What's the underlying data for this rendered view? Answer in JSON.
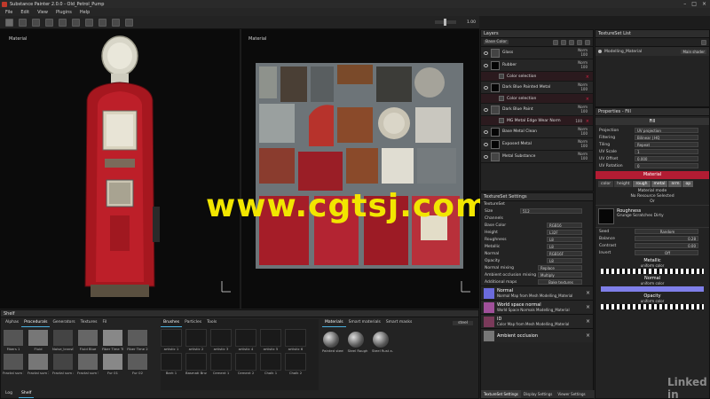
{
  "window": {
    "title": "Substance Painter 2.0.0 - Old_Petrol_Pump"
  },
  "menu": [
    "File",
    "Edit",
    "View",
    "Plugins",
    "Help"
  ],
  "viewport": {
    "left_label": "Material",
    "right_label": "Material",
    "zoom": "1.00"
  },
  "layers": {
    "title": "Layers",
    "blend_select": "Base Color",
    "items": [
      {
        "name": "Glass",
        "blend": "Norm",
        "opacity": "100",
        "mask": false,
        "thumb": "grey"
      },
      {
        "name": "Rubber",
        "blend": "Norm",
        "opacity": "100",
        "mask": false,
        "thumb": "black"
      },
      {
        "name": "Color selection",
        "mask": true
      },
      {
        "name": "Dark Blue Painted Metal",
        "blend": "Norm",
        "opacity": "100",
        "mask": false,
        "thumb": "black"
      },
      {
        "name": "Color selection",
        "mask": true
      },
      {
        "name": "Dark Blue Paint",
        "blend": "Norm",
        "opacity": "100",
        "mask": false,
        "thumb": "grey"
      },
      {
        "name": "MG Metal Edge Wear Norm",
        "blend": "100",
        "opacity": "",
        "mask": true
      },
      {
        "name": "Base Metal Clean",
        "blend": "Norm",
        "opacity": "100",
        "mask": false,
        "thumb": "black"
      },
      {
        "name": "Exposed Metal",
        "blend": "Norm",
        "opacity": "100",
        "mask": false,
        "thumb": "black"
      },
      {
        "name": "Metal Substance",
        "blend": "Norm",
        "opacity": "100",
        "mask": false,
        "thumb": "grey"
      }
    ]
  },
  "texture_set_list": {
    "title": "TextureSet List",
    "item": "Modelling_Material",
    "shader": "Main shader"
  },
  "texture_set_settings": {
    "title": "TextureSet Settings",
    "stack": "TextureSet",
    "size_label": "Size",
    "size_value": "512",
    "channels_label": "Channels",
    "channels": [
      {
        "name": "Base Color",
        "format": "RGB16"
      },
      {
        "name": "Height",
        "format": "L32F"
      },
      {
        "name": "Roughness",
        "format": "L8"
      },
      {
        "name": "Metallic",
        "format": "L8"
      },
      {
        "name": "Normal",
        "format": "RGB16F"
      },
      {
        "name": "Opacity",
        "format": "L8"
      }
    ],
    "normal_mixing_label": "Normal mixing",
    "normal_mixing_value": "Replace",
    "ao_mixing_label": "Ambient occlusion mixing",
    "ao_mixing_value": "Multiply",
    "additional_maps_label": "Additional maps",
    "bake_button": "Bake textures",
    "maps": [
      {
        "title": "Normal",
        "desc": "Normal Map from Mesh Modelling_Material",
        "color": "#6b6bdc"
      },
      {
        "title": "World space normal",
        "desc": "World Space Normals Modelling_Material",
        "color": "#a0509a"
      },
      {
        "title": "ID",
        "desc": "Color Map from Mesh Modelling_Material",
        "color": "#7a3a5a"
      },
      {
        "title": "Ambient occlusion",
        "desc": "",
        "color": "#777777"
      }
    ],
    "bottom_tabs": [
      "TextureSet Settings",
      "Display Settings",
      "Viewer Settings"
    ]
  },
  "properties": {
    "title": "Properties - Fill",
    "fill_header": "Fill",
    "rows": [
      {
        "label": "Projection",
        "value": "UV projection"
      },
      {
        "label": "Filtering",
        "value": "Bilinear | HQ"
      },
      {
        "label": "Tiling",
        "value": "Repeat"
      },
      {
        "label": "UV Scale",
        "value": "1"
      },
      {
        "label": "UV Offset",
        "value": "0.000"
      },
      {
        "label": "UV Rotation",
        "value": "0"
      }
    ],
    "material_header": "Material",
    "channel_tabs": [
      "color",
      "height",
      "rough",
      "metal",
      "nrm",
      "op"
    ],
    "material_mode_label": "Material mode",
    "material_mode_value": "No Resource Selected",
    "or_text": "Or",
    "roughness_title": "Roughness",
    "roughness_value": "Grunge Scratches Dirty",
    "seed_label": "Seed",
    "seed_value": "Random",
    "balance_label": "Balance",
    "balance_value": "0.28",
    "contrast_label": "Contrast",
    "contrast_value": "0.00",
    "invert_label": "Invert",
    "invert_value": "Off",
    "metallic_title": "Metallic",
    "metallic_sub": "uniform color",
    "normal_title": "Normal",
    "normal_sub": "uniform color",
    "opacity_title": "Opacity",
    "opacity_sub": "uniform color"
  },
  "shelf": {
    "title": "Shelf",
    "left_tabs": [
      "Alphas",
      "Procedurals",
      "Generators",
      "Textures",
      "Fil"
    ],
    "left_items": [
      "Fibers 1",
      "Fluid",
      "Noise_transf...",
      "Fluid Blue",
      "Fiber Time Th...",
      "Fiber Time 2",
      "Fractal sum 1",
      "Fractal sum 2",
      "Fractal sum 4",
      "Fractal sum 5",
      "Fur 01",
      "Fur 02"
    ],
    "brush_tabs": [
      "Brushes",
      "Particles",
      "Tools"
    ],
    "brushes": [
      "artistic 1",
      "artistic 2",
      "artistic 3",
      "artistic 4",
      "artistic 5",
      "artistic 6",
      "Bark 1",
      "Basmati Brush",
      "Cement 1",
      "Cement 2",
      "Chalk 1",
      "Chalk 2"
    ],
    "material_tabs": [
      "Materials",
      "Smart materials",
      "Smart masks"
    ],
    "materials": [
      "Painted steel",
      "Steel Rough",
      "Steel Rust a..."
    ],
    "search_value": "steel",
    "bottom_tabs": [
      "Log",
      "Shelf"
    ]
  },
  "watermark": "www.cgtsj.com",
  "brand": "Linked in",
  "colors": {
    "accent_red": "#c8203a",
    "selection_blue": "#4ab0e0",
    "watermark_yellow": "#f2e600",
    "bg_dark": "#1c1c1c"
  }
}
